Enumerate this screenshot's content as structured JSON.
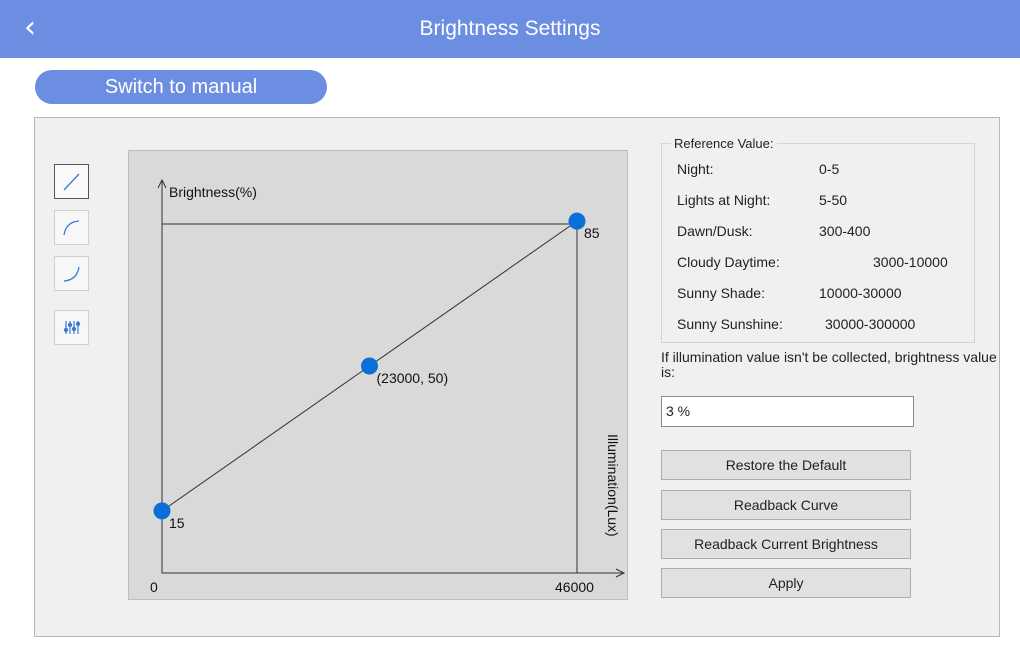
{
  "header": {
    "title": "Brightness Settings",
    "back_glyph": "‹",
    "background_color": "#6b8ee3"
  },
  "mode_button": {
    "label": "Switch to manual"
  },
  "toolbar": {
    "tools": [
      {
        "icon": "linear-curve-icon",
        "active": true
      },
      {
        "icon": "convex-curve-icon",
        "active": false
      },
      {
        "icon": "concave-curve-icon",
        "active": false
      },
      {
        "icon": "equalizer-sliders-icon",
        "active": false
      }
    ]
  },
  "chart_data": {
    "type": "line",
    "ylabel": "Brightness(%)",
    "xlabel": "Illumination(Lux)",
    "xlim": [
      0,
      46000
    ],
    "ylim": [
      0,
      100
    ],
    "x_tick_labels": [
      "0",
      "46000"
    ],
    "points": [
      {
        "x": 0,
        "y": 15,
        "label": "15"
      },
      {
        "x": 23000,
        "y": 50,
        "label": "(23000, 50)"
      },
      {
        "x": 46000,
        "y": 85,
        "label": "85"
      }
    ],
    "point_color": "#0a6fd6",
    "line_color": "#333333"
  },
  "reference": {
    "title": "Reference Value:",
    "rows": [
      {
        "label": "Night:",
        "value": "0-5"
      },
      {
        "label": "Lights at Night:",
        "value": "5-50"
      },
      {
        "label": "Dawn/Dusk:",
        "value": "300-400"
      },
      {
        "label": "Cloudy Daytime:",
        "value": "3000-10000"
      },
      {
        "label": "Sunny Shade:",
        "value": "10000-30000"
      },
      {
        "label": "Sunny Sunshine:",
        "value": "30000-300000"
      }
    ]
  },
  "fallback": {
    "text": "If illumination value isn't be collected, brightness value is:",
    "value": "3 %"
  },
  "actions": {
    "restore": "Restore the Default",
    "readback_curve": "Readback Curve",
    "readback_brightness": "Readback Current Brightness",
    "apply": "Apply"
  }
}
